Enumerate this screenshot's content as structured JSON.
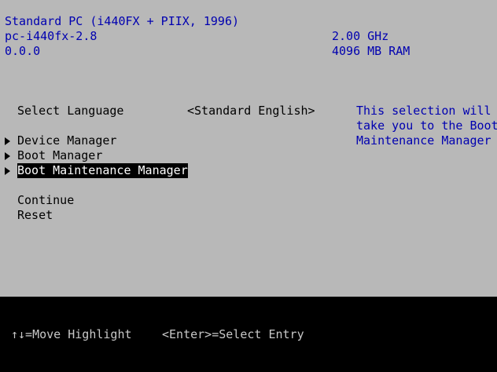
{
  "system_info": {
    "machine": "Standard PC (i440FX + PIIX, 1996)",
    "machine_type": "pc-i440fx-2.8",
    "firmware_version": "0.0.0",
    "cpu_speed": "2.00 GHz",
    "memory": "4096 MB RAM"
  },
  "menu": {
    "language_label": "Select Language",
    "language_value": "<Standard English>",
    "items": [
      {
        "label": "Device Manager"
      },
      {
        "label": "Boot Manager"
      },
      {
        "label": "Boot Maintenance Manager",
        "selected": true
      }
    ],
    "continue_label": "Continue",
    "reset_label": "Reset"
  },
  "help": {
    "line1": "This selection will",
    "line2": "take you to the Boot",
    "line3": "Maintenance Manager"
  },
  "footer": {
    "move_hint": "↑↓=Move Highlight",
    "enter_hint": "<Enter>=Select Entry"
  },
  "colors": {
    "panel_background": "#b8b8b8",
    "info_text": "#0000b0",
    "menu_text": "#000000",
    "footer_background": "#000000",
    "footer_text": "#c8c8c8"
  }
}
